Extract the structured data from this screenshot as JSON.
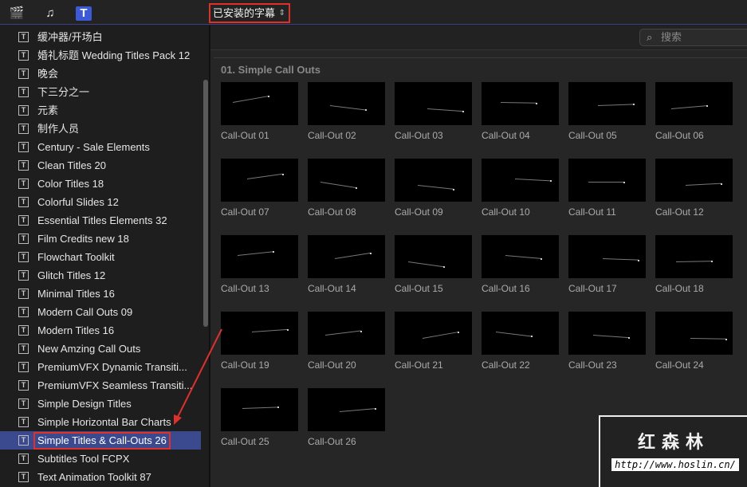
{
  "toolbar": {
    "icons": [
      "clapper-star-icon",
      "music-notes-icon",
      "titles-icon"
    ],
    "library_select": "已安装的字幕",
    "chev": "⌃⌄"
  },
  "search": {
    "placeholder": "搜索",
    "icon": "⌕"
  },
  "sidebar": {
    "items": [
      "缓冲器/开场白",
      "婚礼标题 Wedding Titles Pack 12",
      "晚会",
      "下三分之一",
      "元素",
      "制作人员",
      "Century - Sale Elements",
      "Clean Titles 20",
      "Color Titles 18",
      "Colorful Slides 12",
      "Essential Titles Elements 32",
      "Film Credits new 18",
      "Flowchart Toolkit",
      "Glitch Titles 12",
      "Minimal Titles 16",
      "Modern Call Outs 09",
      "Modern Titles 16",
      "New Amzing Call Outs",
      "PremiumVFX Dynamic Transiti...",
      "PremiumVFX Seamless Transiti...",
      "Simple Design Titles",
      "Simple Horizontal Bar Charts",
      "Simple Titles & Call-Outs 26",
      "Subtitles Tool FCPX",
      "Text Animation Toolkit 87"
    ],
    "selected_index": 22
  },
  "browser": {
    "section": "01. Simple Call Outs",
    "tiles": [
      "Call-Out 01",
      "Call-Out 02",
      "Call-Out 03",
      "Call-Out 04",
      "Call-Out 05",
      "Call-Out 06",
      "Call-Out 07",
      "Call-Out 08",
      "Call-Out 09",
      "Call-Out 10",
      "Call-Out 11",
      "Call-Out 12",
      "Call-Out 13",
      "Call-Out 14",
      "Call-Out 15",
      "Call-Out 16",
      "Call-Out 17",
      "Call-Out 18",
      "Call-Out 19",
      "Call-Out 20",
      "Call-Out 21",
      "Call-Out 22",
      "Call-Out 23",
      "Call-Out 24",
      "Call-Out 25",
      "Call-Out 26"
    ]
  },
  "watermark": {
    "title": "红森林",
    "url": "http://www.hoslin.cn/"
  },
  "colors": {
    "selection": "#3b4a8f",
    "highlight": "#e0302a"
  }
}
